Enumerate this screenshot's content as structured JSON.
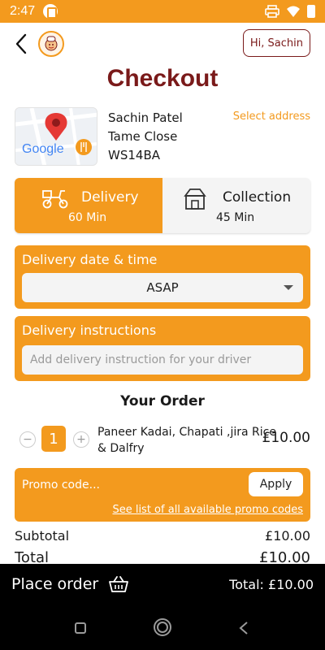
{
  "status_bar": {
    "time": "2:47"
  },
  "header": {
    "greeting": "Hi, Sachin"
  },
  "page": {
    "title": "Checkout"
  },
  "address": {
    "map_label": "Google",
    "name": "Sachin Patel",
    "street": "Tame Close",
    "postcode": "WS14BA",
    "select_label": "Select address"
  },
  "fulfilment": {
    "delivery": {
      "label": "Delivery",
      "time": "60 Min",
      "active": true
    },
    "collection": {
      "label": "Collection",
      "time": "45 Min",
      "active": false
    }
  },
  "delivery_time": {
    "title": "Delivery date & time",
    "selected": "ASAP"
  },
  "instructions": {
    "title": "Delivery instructions",
    "placeholder": "Add delivery instruction for your driver"
  },
  "order": {
    "heading": "Your Order",
    "items": [
      {
        "qty": "1",
        "name": "Paneer Kadai, Chapati ,jira Rice & Dalfry",
        "price": "£10.00"
      }
    ],
    "minus_label": "−",
    "plus_label": "+"
  },
  "promo": {
    "placeholder": "Promo code...",
    "apply_label": "Apply",
    "link_label": "See list of all available promo codes"
  },
  "summary": {
    "subtotal_label": "Subtotal",
    "subtotal_value": "£10.00",
    "total_label": "Total",
    "total_value": "£10.00"
  },
  "footer": {
    "place_order_label": "Place order",
    "total_label": "Total: £10.00"
  },
  "colors": {
    "accent": "#f39a1e",
    "brand_dark": "#7a1a1a",
    "bar": "#000000"
  }
}
